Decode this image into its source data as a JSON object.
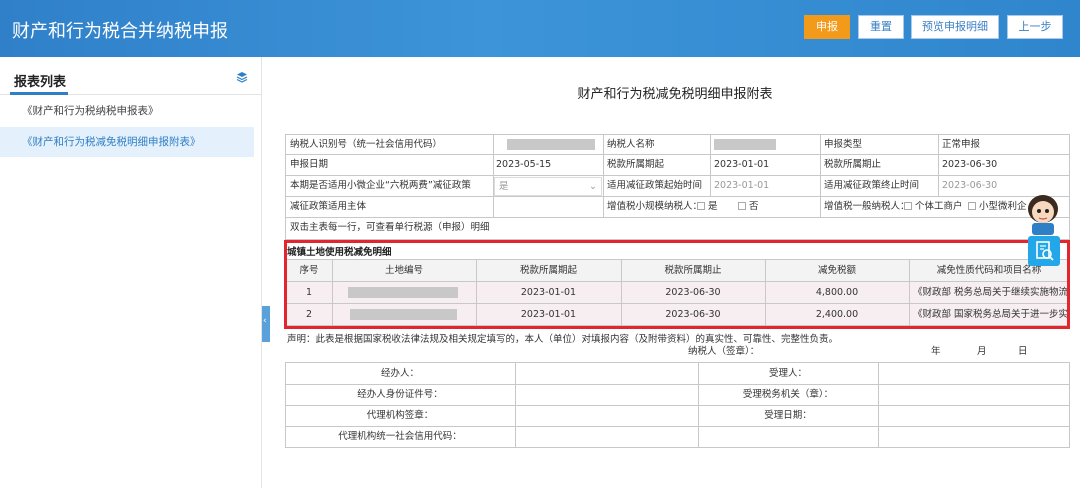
{
  "header": {
    "app_title": "财产和行为税合并纳税申报",
    "buttons": {
      "submit": "申报",
      "reset": "重置",
      "preview": "预览申报明细",
      "back": "上一步"
    }
  },
  "sidebar": {
    "title": "报表列表",
    "items": [
      {
        "label": "《财产和行为税纳税申报表》"
      },
      {
        "label": "《财产和行为税减免税明细申报附表》"
      }
    ]
  },
  "form": {
    "title": "财产和行为税减免税明细申报附表",
    "info": {
      "taxpayer_id_label": "纳税人识别号（统一社会信用代码）",
      "taxpayer_name_label": "纳税人名称",
      "declare_type_label": "申报类型",
      "declare_type_value": "正常申报",
      "declare_date_label": "申报日期",
      "declare_date_value": "2023-05-15",
      "period_start_label": "税款所属期起",
      "period_start_value": "2023-01-01",
      "period_end_label": "税款所属期止",
      "period_end_value": "2023-06-30",
      "small_biz_label": "本期是否适用小微企业“六税两费”减征政策",
      "small_biz_value": "是",
      "policy_start_label": "适用减征政策起始时间",
      "policy_start_value": "2023-01-01",
      "policy_end_label": "适用减征政策终止时间",
      "policy_end_value": "2023-06-30",
      "policy_subject_label": "减征政策适用主体",
      "vat_small_label": "增值税小规模纳税人：",
      "yes": "是",
      "no": "否",
      "vat_general_label": "增值税一般纳税人：",
      "individual": "个体工商户",
      "small_micro": "小型微利企",
      "hint": "双击主表每一行，可查看单行税源（申报）明细"
    },
    "detail": {
      "section_title": "城镇土地使用税减免明细",
      "columns": [
        "序号",
        "土地编号",
        "税款所属期起",
        "税款所属期止",
        "减免税额",
        "减免性质代码和项目名称"
      ],
      "rows": [
        {
          "no": "1",
          "start": "2023-01-01",
          "end": "2023-06-30",
          "amount": "4,800.00",
          "nature": "《财政部 税务总局关于继续实施物流企"
        },
        {
          "no": "2",
          "start": "2023-01-01",
          "end": "2023-06-30",
          "amount": "2,400.00",
          "nature": "《财政部 国家税务总局关于进一步实施"
        }
      ]
    },
    "declaration": {
      "statement": "声明：此表是根据国家税收法律法规及相关规定填写的，本人（单位）对填报内容（及附带资料）的真实性、可靠性、完整性负责。",
      "signer_label": "纳税人（签章）：",
      "year": "年",
      "month": "月",
      "day": "日",
      "agent_label": "经办人：",
      "agent_id_label": "经办人身份证件号：",
      "agency_seal_label": "代理机构签章：",
      "agency_credit_label": "代理机构统一社会信用代码：",
      "receiver_label": "受理人：",
      "tax_office_label": "受理税务机关（章）：",
      "accept_date_label": "受理日期："
    }
  },
  "colors": {
    "header_blue": "#3d94d8",
    "submit_orange": "#f39a1a",
    "highlight_red": "#e3262e"
  }
}
